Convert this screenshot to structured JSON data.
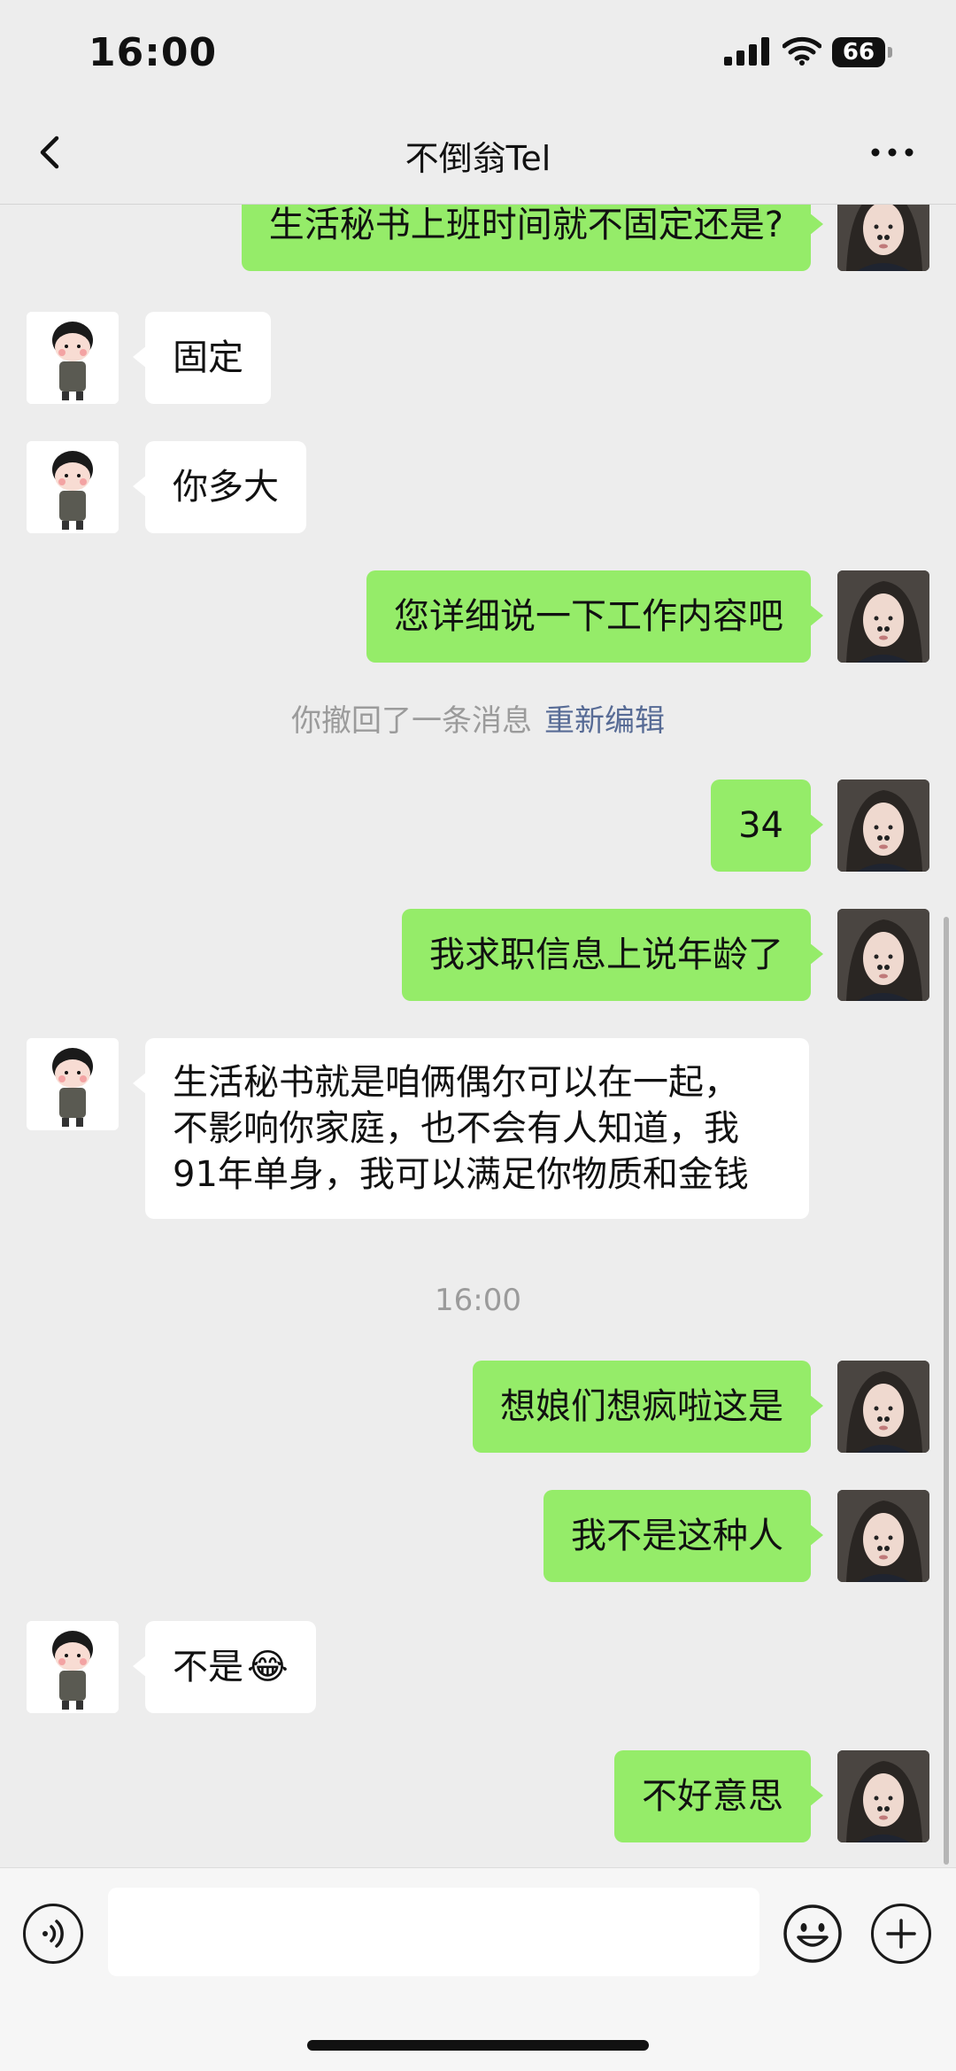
{
  "status_bar": {
    "time": "16:00",
    "battery": "66"
  },
  "nav": {
    "title": "不倒翁Tel"
  },
  "messages": [
    {
      "side": "right",
      "text": "生活秘书上班时间就不固定还是?"
    },
    {
      "side": "left",
      "text": "固定"
    },
    {
      "side": "left",
      "text": "你多大"
    },
    {
      "side": "right",
      "text": "您详细说一下工作内容吧"
    },
    {
      "side": "right",
      "text": "34"
    },
    {
      "side": "right",
      "text": "我求职信息上说年龄了"
    },
    {
      "side": "left",
      "lines": [
        "生活秘书就是咱俩偶尔可以在一起，",
        "不影响你家庭，也不会有人知道，我",
        "91年单身，我可以满足你物质和金钱"
      ]
    },
    {
      "side": "right",
      "text": "想娘们想疯啦这是"
    },
    {
      "side": "right",
      "text": "我不是这种人"
    },
    {
      "side": "left",
      "text": "不是",
      "emoji": "😂"
    },
    {
      "side": "right",
      "text": "不好意思"
    }
  ],
  "system": {
    "recall_text": "你撤回了一条消息",
    "reedit": "重新编辑",
    "timestamp": "16:00"
  },
  "colors": {
    "sent_bubble": "#95ec69",
    "received_bubble": "#ffffff",
    "background": "#ededed",
    "link": "#576b95"
  },
  "icons": [
    "back-icon",
    "more-icon",
    "voice-icon",
    "emoji-icon",
    "plus-icon"
  ]
}
